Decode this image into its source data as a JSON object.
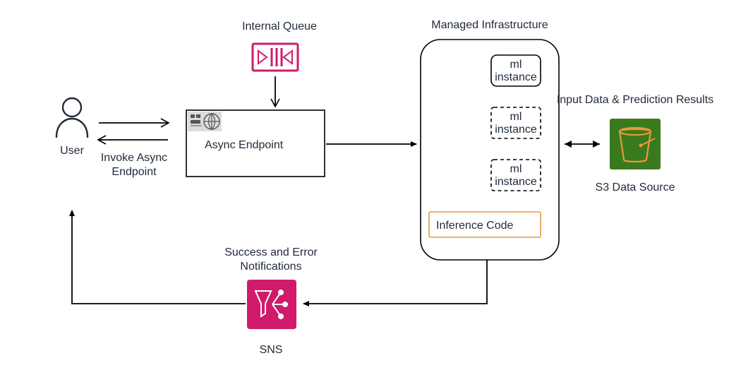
{
  "queue": {
    "label": "Internal Queue"
  },
  "infra": {
    "title": "Managed Infrastructure"
  },
  "user": {
    "label": "User"
  },
  "invoke": {
    "line1": "Invoke Async",
    "line2": "Endpoint"
  },
  "endpoint": {
    "label": "Async Endpoint"
  },
  "mi": {
    "label1": "ml",
    "label2": "instance"
  },
  "inference": {
    "label": "Inference Code"
  },
  "s3": {
    "top": "Input Data & Prediction Results",
    "bottom": "S3 Data Source"
  },
  "sns": {
    "top1": "Success and Error",
    "top2": "Notifications",
    "bottom": "SNS"
  },
  "colors": {
    "pink": "#cf1b6a",
    "orange": "#e89a3c",
    "green": "#3a7a1e",
    "navy": "#1f2a3a"
  }
}
